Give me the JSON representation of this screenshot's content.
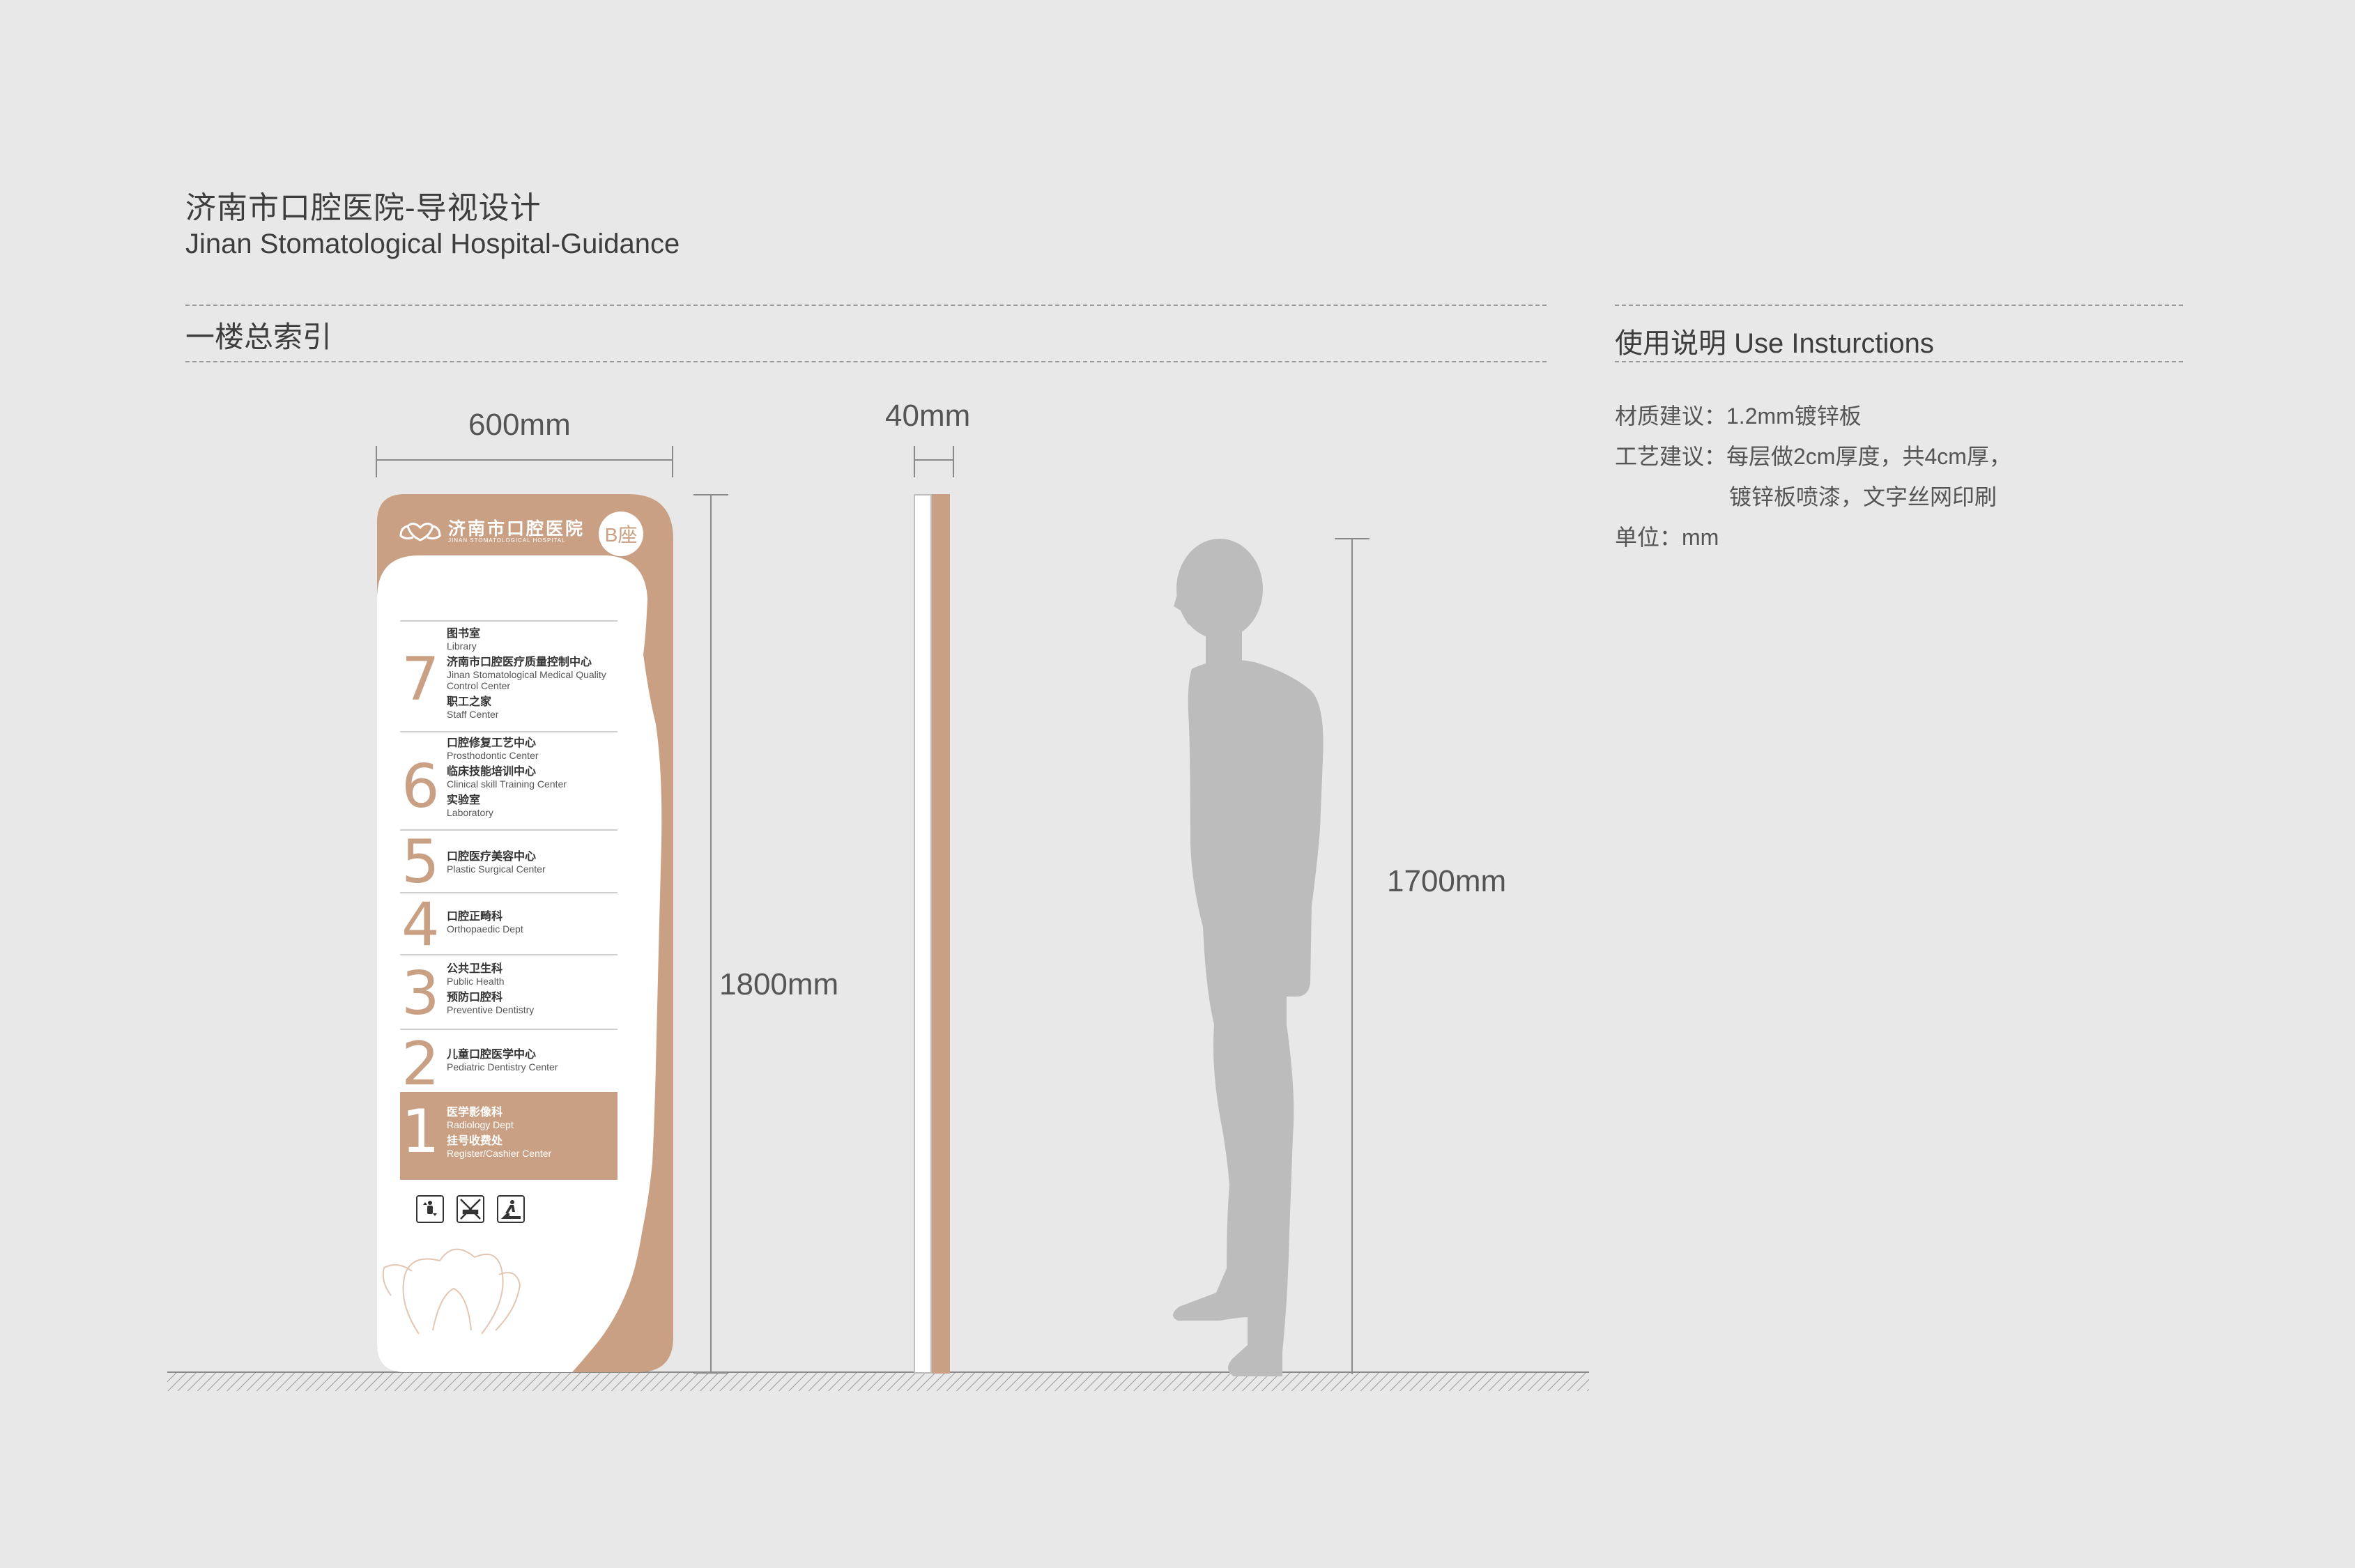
{
  "header": {
    "title_cn": "济南市口腔医院-导视设计",
    "title_en": "Jinan Stomatological Hospital-Guidance",
    "section": "一楼总索引"
  },
  "usage": {
    "title": "使用说明 Use Insturctions",
    "lines": [
      "材质建议：1.2mm镀锌板",
      "工艺建议：每层做2cm厚度，共4cm厚，",
      "镀锌板喷漆，文字丝网印刷",
      "单位：mm"
    ]
  },
  "dimensions": {
    "width": "600mm",
    "thickness": "40mm",
    "sign_height": "1800mm",
    "person_height": "1700mm"
  },
  "sign": {
    "logo_cn": "济南市口腔医院",
    "logo_en": "JINAN STOMATOLOGICAL HOSPITAL",
    "badge": "B座",
    "floors": [
      {
        "num": "7",
        "items": [
          {
            "cn": "图书室",
            "en": "Library"
          },
          {
            "cn": "济南市口腔医疗质量控制中心",
            "en": "Jinan Stomatological Medical Quality Control Center"
          },
          {
            "cn": "职工之家",
            "en": "Staff Center"
          }
        ]
      },
      {
        "num": "6",
        "items": [
          {
            "cn": "口腔修复工艺中心",
            "en": "Prosthodontic Center"
          },
          {
            "cn": "临床技能培训中心",
            "en": "Clinical skill Training Center"
          },
          {
            "cn": "实验室",
            "en": "Laboratory"
          }
        ]
      },
      {
        "num": "5",
        "items": [
          {
            "cn": "口腔医疗美容中心",
            "en": "Plastic Surgical Center"
          }
        ]
      },
      {
        "num": "4",
        "items": [
          {
            "cn": "口腔正畸科",
            "en": "Orthopaedic Dept"
          }
        ]
      },
      {
        "num": "3",
        "items": [
          {
            "cn": "公共卫生科",
            "en": "Public Health"
          },
          {
            "cn": "预防口腔科",
            "en": "Preventive Dentistry"
          }
        ]
      },
      {
        "num": "2",
        "items": [
          {
            "cn": "儿童口腔医学中心",
            "en": "Pediatric Dentistry Center"
          }
        ]
      },
      {
        "num": "1",
        "items": [
          {
            "cn": "医学影像科",
            "en": "Radiology Dept"
          },
          {
            "cn": "挂号收费处",
            "en": "Register/Cashier Center"
          }
        ]
      }
    ],
    "facility_icons": [
      "elevator-icon",
      "no-smoking-icon",
      "escalator-icon"
    ]
  },
  "colors": {
    "accent": "#c9a083",
    "background": "#e8e8e8",
    "person": "#bcbcbc"
  }
}
